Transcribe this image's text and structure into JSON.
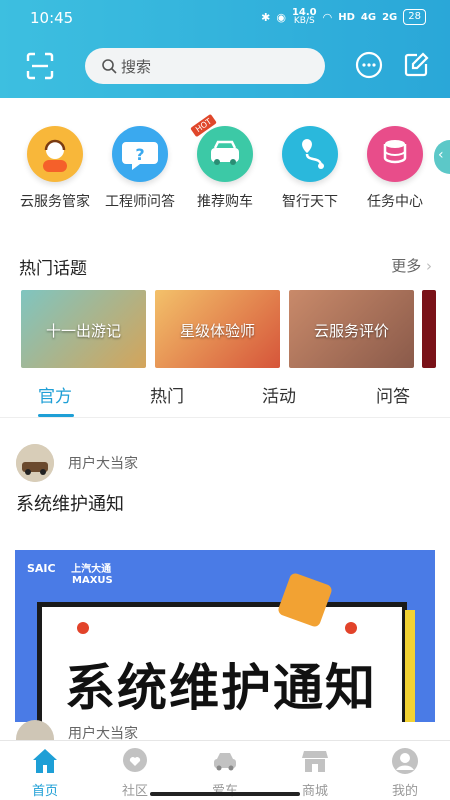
{
  "status": {
    "time": "10:45",
    "net_speed": "14.0",
    "net_unit": "KB/S",
    "battery": "28",
    "hd": "HD",
    "sig1": "4G",
    "sig2": "2G"
  },
  "search": {
    "placeholder": "搜索"
  },
  "quick_menu": [
    {
      "label": "云服务管家",
      "icon": "customer-service-icon",
      "color": "#f8b73a"
    },
    {
      "label": "工程师问答",
      "icon": "question-bubble-icon",
      "color": "#3aa9ef"
    },
    {
      "label": "推荐购车",
      "icon": "car-icon",
      "color": "#3cc9a6",
      "badge": "HOT"
    },
    {
      "label": "智行天下",
      "icon": "route-icon",
      "color": "#2ab8dc"
    },
    {
      "label": "任务中心",
      "icon": "coins-icon",
      "color": "#e84d8a"
    }
  ],
  "hot_topics": {
    "title": "热门话题",
    "more": "更多",
    "cards": [
      {
        "label": "十一出游记",
        "color": "#5aa7a0"
      },
      {
        "label": "星级体验师",
        "color": "#e08a3c"
      },
      {
        "label": "云服务评价",
        "color": "#b96a5a"
      }
    ]
  },
  "tabs": [
    "官方",
    "热门",
    "活动",
    "问答"
  ],
  "post": {
    "author": "用户大当家",
    "title": "系统维护通知",
    "banner_text": "系统维护通知",
    "brand_line1": "上汽大通",
    "brand_line2": "MAXUS",
    "brand_badge": "SAIC"
  },
  "post2": {
    "author": "用户大当家"
  },
  "bottom_nav": [
    {
      "label": "首页",
      "icon": "home-icon",
      "active": true
    },
    {
      "label": "社区",
      "icon": "heart-bubble-icon",
      "active": false
    },
    {
      "label": "爱车",
      "icon": "car-icon",
      "active": false
    },
    {
      "label": "商城",
      "icon": "store-icon",
      "active": false
    },
    {
      "label": "我的",
      "icon": "profile-icon",
      "active": false
    }
  ],
  "colors": {
    "accent": "#1e9fd6",
    "header_start": "#3dbfe0",
    "header_end": "#2aa7d8"
  }
}
